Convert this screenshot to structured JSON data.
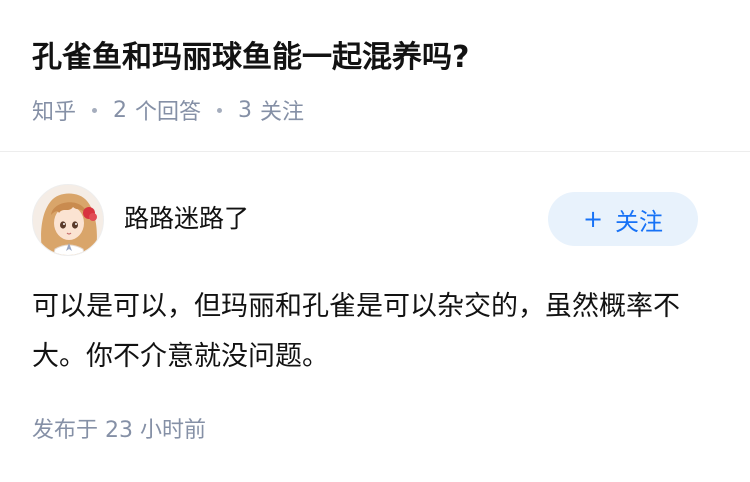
{
  "question": {
    "title": "孔雀鱼和玛丽球鱼能一起混养吗?",
    "source": "知乎",
    "answer_count": "2",
    "answer_label": "个回答",
    "follower_count": "3",
    "follower_label": "关注"
  },
  "answer": {
    "author_name": "路路迷路了",
    "avatar_icon": "anime-girl-avatar",
    "follow_button": {
      "plus": "+",
      "label": "关注"
    },
    "content": "可以是可以，但玛丽和孔雀是可以杂交的，虽然概率不大。你不介意就没问题。",
    "published_prefix": "发布于",
    "published_time": "23 小时前"
  },
  "colors": {
    "primary_text": "#121212",
    "secondary_text": "#8590a6",
    "accent": "#1772f6",
    "follow_bg": "#e8f2fc"
  }
}
